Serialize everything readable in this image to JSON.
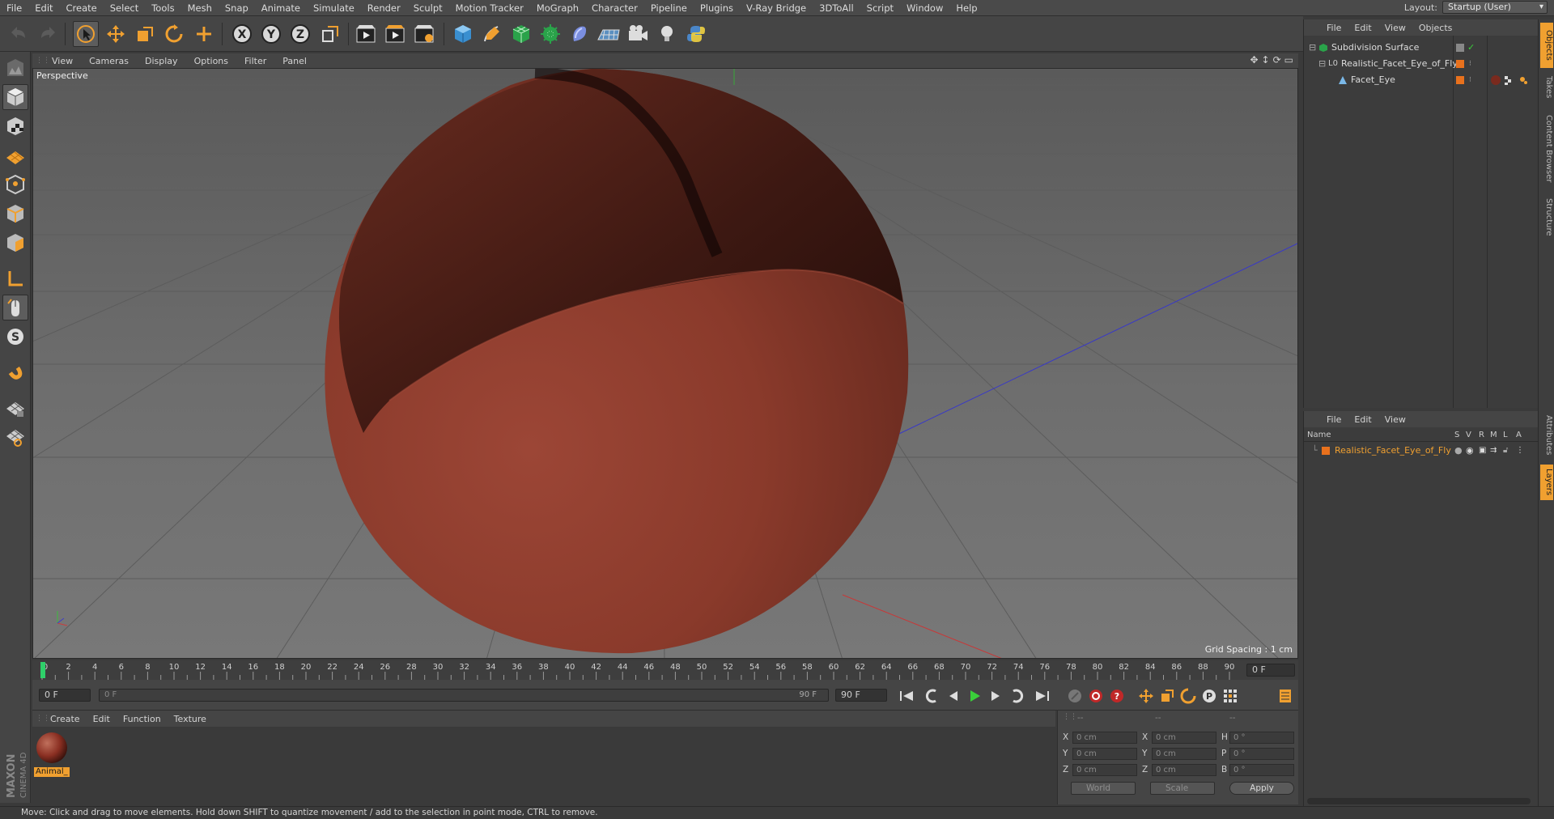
{
  "menubar": {
    "items": [
      "File",
      "Edit",
      "Create",
      "Select",
      "Tools",
      "Mesh",
      "Snap",
      "Animate",
      "Simulate",
      "Render",
      "Sculpt",
      "Motion Tracker",
      "MoGraph",
      "Character",
      "Pipeline",
      "Plugins",
      "V-Ray Bridge",
      "3DToAll",
      "Script",
      "Window",
      "Help"
    ],
    "layout_label": "Layout:",
    "layout_value": "Startup (User)"
  },
  "toolbar": {
    "icons": [
      "undo-icon",
      "redo-icon",
      "select-arrow-icon",
      "move-icon",
      "scale-icon",
      "rotate-icon",
      "transform-icon",
      "x-axis-icon",
      "y-axis-icon",
      "z-axis-icon",
      "coordinate-system-icon",
      "render-view-icon",
      "render-picture-viewer-icon",
      "edit-render-settings-icon",
      "cube-icon",
      "pen-icon",
      "subdivision-icon",
      "cloner-icon",
      "deformer-icon",
      "floor-icon",
      "camera-icon",
      "light-icon",
      "python-icon"
    ],
    "axis_x": "X",
    "axis_y": "Y",
    "axis_z": "Z"
  },
  "viewport": {
    "menu": [
      "View",
      "Cameras",
      "Display",
      "Options",
      "Filter",
      "Panel"
    ],
    "label": "Perspective",
    "grid_spacing": "Grid Spacing : 1 cm"
  },
  "timeline": {
    "ticks": [
      "0",
      "2",
      "4",
      "6",
      "8",
      "10",
      "12",
      "14",
      "16",
      "18",
      "20",
      "22",
      "24",
      "26",
      "28",
      "30",
      "32",
      "34",
      "36",
      "38",
      "40",
      "42",
      "44",
      "46",
      "48",
      "50",
      "52",
      "54",
      "56",
      "58",
      "60",
      "62",
      "64",
      "66",
      "68",
      "70",
      "72",
      "74",
      "76",
      "78",
      "80",
      "82",
      "84",
      "86",
      "88",
      "90"
    ],
    "current_frame": "0 F"
  },
  "transport": {
    "start_field": "0 F",
    "range_start": "0 F",
    "range_end": "90 F",
    "end_field": "90 F"
  },
  "materials": {
    "menu": [
      "Create",
      "Edit",
      "Function",
      "Texture"
    ],
    "items": [
      {
        "name": "Animal_",
        "color": "#8a2f22"
      }
    ]
  },
  "coordinates": {
    "header": [
      "--",
      "--",
      "--"
    ],
    "rows": [
      {
        "a": "X",
        "av": "0 cm",
        "b": "X",
        "bv": "0 cm",
        "c": "H",
        "cv": "0 °"
      },
      {
        "a": "Y",
        "av": "0 cm",
        "b": "Y",
        "bv": "0 cm",
        "c": "P",
        "cv": "0 °"
      },
      {
        "a": "Z",
        "av": "0 cm",
        "b": "Z",
        "bv": "0 cm",
        "c": "B",
        "cv": "0 °"
      }
    ],
    "world": "World",
    "scale": "Scale",
    "apply": "Apply"
  },
  "objects": {
    "menu": [
      "File",
      "Edit",
      "View",
      "Objects"
    ],
    "tree": [
      {
        "name": "Subdivision Surface",
        "indent": 0
      },
      {
        "name": "Realistic_Facet_Eye_of_Fly",
        "indent": 1
      },
      {
        "name": "Facet_Eye",
        "indent": 2
      }
    ]
  },
  "layers": {
    "menu": [
      "File",
      "Edit",
      "View"
    ],
    "columns": {
      "name": "Name",
      "s": "S",
      "v": "V",
      "r": "R",
      "m": "M",
      "l": "L",
      "a": "A"
    },
    "rows": [
      {
        "name": "Realistic_Facet_Eye_of_Fly",
        "color": "#e8711d"
      }
    ]
  },
  "right_tabs": [
    "Objects",
    "Takes",
    "Content Browser",
    "Structure",
    "Attributes",
    "Layers"
  ],
  "status": "Move: Click and drag to move elements. Hold down SHIFT to quantize movement / add to the selection in point mode, CTRL to remove.",
  "colors": {
    "accent": "#f0a030",
    "viewport_bg": "#6b6b6b",
    "sphere": "#8a3828",
    "layer_text": "#f0a030"
  }
}
